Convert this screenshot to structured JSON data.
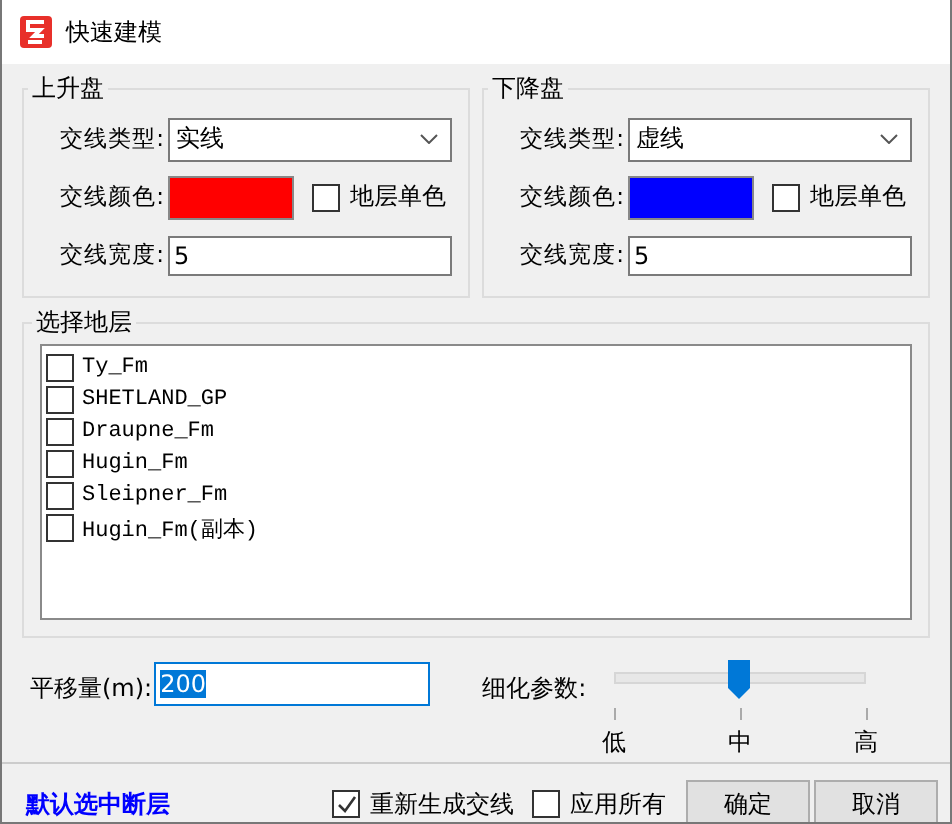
{
  "window": {
    "title": "快速建模"
  },
  "groups": [
    {
      "title": "上升盘",
      "type_label": "交线类型:",
      "type_value": "实线",
      "color_label": "交线颜色:",
      "color": "#ff0000",
      "single_color": {
        "label": "地层单色",
        "checked": false
      },
      "width_label": "交线宽度:",
      "width_value": "5"
    },
    {
      "title": "下降盘",
      "type_label": "交线类型:",
      "type_value": "虚线",
      "color_label": "交线颜色:",
      "color": "#0000ff",
      "single_color": {
        "label": "地层单色",
        "checked": false
      },
      "width_label": "交线宽度:",
      "width_value": "5"
    }
  ],
  "layers": {
    "title": "选择地层",
    "items": [
      {
        "label": "Ty_Fm",
        "checked": false
      },
      {
        "label": "SHETLAND_GP",
        "checked": false
      },
      {
        "label": "Draupne_Fm",
        "checked": false
      },
      {
        "label": "Hugin_Fm",
        "checked": false
      },
      {
        "label": "Sleipner_Fm",
        "checked": false
      },
      {
        "label": "Hugin_Fm(副本)",
        "checked": false
      }
    ]
  },
  "offset": {
    "label": "平移量(m):",
    "value": "200"
  },
  "refine": {
    "label": "细化参数:",
    "level": 0.5,
    "ticks": [
      "低",
      "中",
      "高"
    ]
  },
  "footer": {
    "link": "默认选中断层",
    "regenerate": {
      "label": "重新生成交线",
      "checked": true
    },
    "apply_all": {
      "label": "应用所有",
      "checked": false
    },
    "buttons": [
      "确定",
      "取消"
    ]
  }
}
